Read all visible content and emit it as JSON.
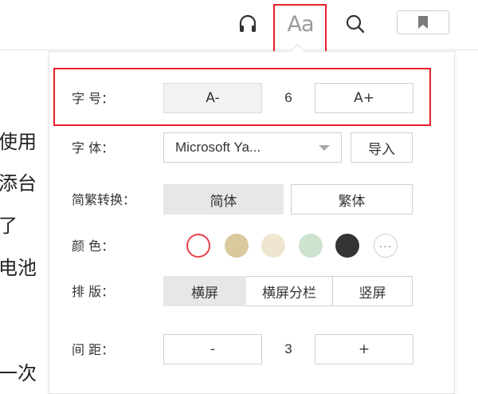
{
  "toolbar": {
    "aa_label": "Aa"
  },
  "book_lines": [
    "使用",
    "添台",
    "了",
    "电池",
    "一次"
  ],
  "panel": {
    "font_size": {
      "label": "字  号：",
      "decrease": "A-",
      "value": "6",
      "increase": "A+"
    },
    "font_family": {
      "label": "字  体：",
      "selected": "Microsoft Ya...",
      "import": "导入"
    },
    "script": {
      "label": "简繁转换：",
      "simplified": "简体",
      "traditional": "繁体"
    },
    "color": {
      "label": "颜  色：",
      "swatches": [
        "#ffffff",
        "#d9c99c",
        "#efe6d2",
        "#cde3cf",
        "#333333"
      ],
      "selected_index": 0
    },
    "layout": {
      "label": "排  版：",
      "options": [
        "横屏",
        "横屏分栏",
        "竖屏"
      ],
      "active_index": 0
    },
    "spacing": {
      "label": "间  距：",
      "decrease": "-",
      "value": "3",
      "increase": "+"
    }
  },
  "colors": {
    "highlight": "#e8202a",
    "active_bg": "#e7e7e7"
  }
}
